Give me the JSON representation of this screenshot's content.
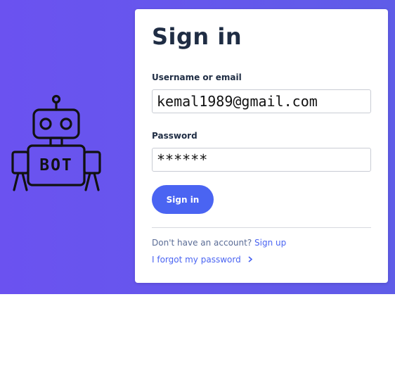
{
  "login": {
    "title": "Sign in",
    "username_label": "Username or email",
    "username_value": "kemal1989@gmail.com",
    "password_label": "Password",
    "password_value": "******",
    "submit_label": "Sign in",
    "no_account_text": "Don't have an account?",
    "signup_link": "Sign up",
    "forgot_link": "I forgot my password"
  },
  "brand": {
    "bot_text": "BOT",
    "icon": "robot-icon"
  },
  "colors": {
    "hero_background": "#6b52f0",
    "accent": "#4a64f2",
    "heading": "#1f2d44"
  }
}
